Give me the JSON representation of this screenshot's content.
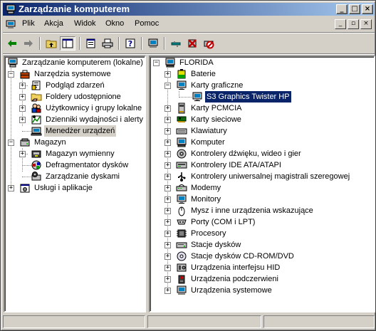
{
  "window": {
    "title": "Zarządzanie komputerem"
  },
  "menu": {
    "items": [
      "Plik",
      "Akcja",
      "Widok",
      "Okno",
      "Pomoc"
    ]
  },
  "toolbar": {
    "buttons": [
      "back-icon",
      "forward-icon",
      "up-folder-icon",
      "show-hide-tree-icon",
      "properties-icon",
      "print-icon",
      "help-icon",
      "scan-hardware-icon",
      "disable-device-icon",
      "uninstall-device-icon",
      "update-driver-icon"
    ]
  },
  "left_tree": {
    "root": "Zarządzanie komputerem (lokalne)",
    "system_tools": "Narzędzia systemowe",
    "event_viewer": "Podgląd zdarzeń",
    "shared_folders": "Foldery udostępnione",
    "local_users": "Użytkownicy i grupy lokalne",
    "perf_logs": "Dzienniki wydajności i alerty",
    "device_manager": "Menedżer urządzeń",
    "storage": "Magazyn",
    "removable_storage": "Magazyn wymienny",
    "defrag": "Defragmentator dysków",
    "disk_mgmt": "Zarządzanie dyskami",
    "services_apps": "Usługi i aplikacje"
  },
  "right_tree": {
    "root": "FLORIDA",
    "display_adapter_child": "S3 Graphics Twister HP",
    "categories": [
      {
        "label": "Baterie",
        "icon": "battery-icon"
      },
      {
        "label": "Karty graficzne",
        "icon": "monitor-icon"
      },
      {
        "label": "Karty PCMCIA",
        "icon": "pcmcia-icon"
      },
      {
        "label": "Karty sieciowe",
        "icon": "network-card-icon"
      },
      {
        "label": "Klawiatury",
        "icon": "keyboard-icon"
      },
      {
        "label": "Komputer",
        "icon": "computer-icon"
      },
      {
        "label": "Kontrolery dźwięku, wideo i gier",
        "icon": "sound-icon"
      },
      {
        "label": "Kontrolery IDE ATA/ATAPI",
        "icon": "ide-controller-icon"
      },
      {
        "label": "Kontrolery uniwersalnej magistrali szeregowej",
        "icon": "usb-icon"
      },
      {
        "label": "Modemy",
        "icon": "modem-icon"
      },
      {
        "label": "Monitory",
        "icon": "monitor-icon"
      },
      {
        "label": "Mysz i inne urządzenia wskazujące",
        "icon": "mouse-icon"
      },
      {
        "label": "Porty (COM i LPT)",
        "icon": "port-icon"
      },
      {
        "label": "Procesory",
        "icon": "processor-icon"
      },
      {
        "label": "Stacje dysków",
        "icon": "disk-drive-icon"
      },
      {
        "label": "Stacje dysków CD-ROM/DVD",
        "icon": "cdrom-icon"
      },
      {
        "label": "Urządzenia interfejsu HID",
        "icon": "hid-icon"
      },
      {
        "label": "Urządzenia podczerwieni",
        "icon": "infrared-icon"
      },
      {
        "label": "Urządzenia systemowe",
        "icon": "system-devices-icon"
      }
    ]
  },
  "status": {
    "panel1": "",
    "panel2": "",
    "panel3": ""
  },
  "colors": {
    "title_start": "#0a246a",
    "title_end": "#a6caf0",
    "face": "#d4d0c8",
    "selection": "#0a246a"
  }
}
